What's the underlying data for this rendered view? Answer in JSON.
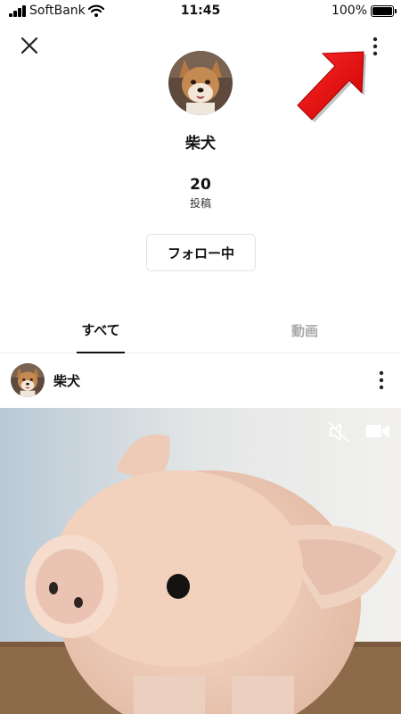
{
  "status_bar": {
    "carrier": "SoftBank",
    "time": "11:45",
    "battery": "100%",
    "icons": [
      "signal-bars-icon",
      "wifi-icon",
      "battery-icon"
    ]
  },
  "header": {
    "icons": [
      "close-icon",
      "more-vertical-icon"
    ]
  },
  "profile": {
    "name": "柴犬",
    "post_count": "20",
    "post_count_label": "投稿",
    "follow_button": "フォロー中"
  },
  "tabs": [
    {
      "label": "すべて",
      "active": true
    },
    {
      "label": "動画",
      "active": false
    }
  ],
  "post": {
    "user": "柴犬",
    "icons": [
      "mute-icon",
      "video-camera-icon",
      "more-vertical-icon"
    ]
  },
  "colors": {
    "annotation_arrow": "#e60000",
    "inactive_tab": "#aaaaaa",
    "text": "#111111"
  }
}
